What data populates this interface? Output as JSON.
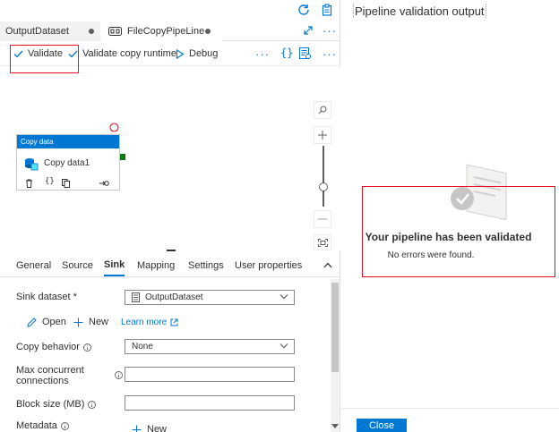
{
  "tabs": [
    {
      "label": "OutputDataset"
    },
    {
      "label": "FileCopyPipeLine"
    }
  ],
  "toolbar": {
    "validate_label": "Validate",
    "validate_copy_label": "Validate copy runtime",
    "debug_label": "Debug"
  },
  "activity": {
    "header": "Copy data",
    "name": "Copy data1"
  },
  "properties": {
    "tabs": [
      "General",
      "Source",
      "Sink",
      "Mapping",
      "Settings",
      "User properties"
    ],
    "active_tab": "Sink",
    "sink_dataset_label": "Sink dataset *",
    "sink_dataset_value": "OutputDataset",
    "open_label": "Open",
    "new_label": "New",
    "learn_more_label": "Learn more",
    "copy_behavior_label": "Copy behavior",
    "copy_behavior_value": "None",
    "max_concurrent_label_1": "Max concurrent",
    "max_concurrent_label_2": "connections",
    "block_size_label": "Block size (MB)",
    "metadata_label": "Metadata",
    "metadata_new_label": "New"
  },
  "validation": {
    "title": "Pipeline validation output",
    "headline": "Your pipeline has been validated",
    "message": "No errors were found.",
    "close_label": "Close"
  },
  "colors": {
    "accent": "#0078d4",
    "highlight": "#e81123",
    "success": "#107c10"
  }
}
